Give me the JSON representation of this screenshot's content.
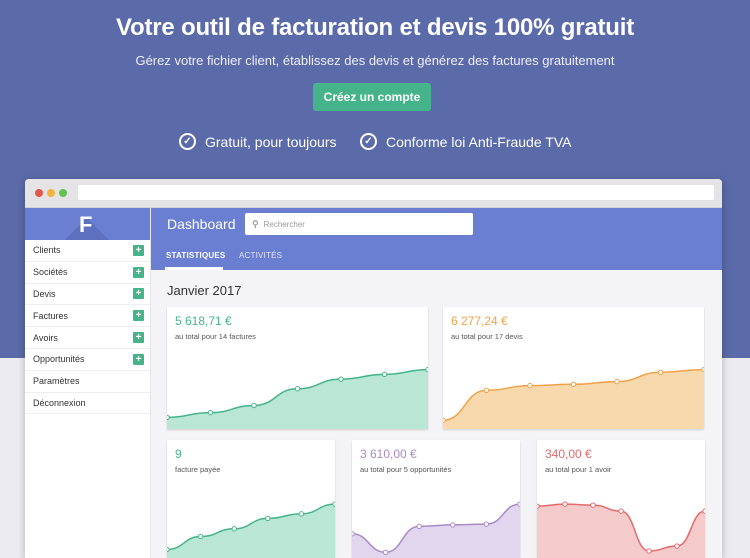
{
  "hero": {
    "headline": "Votre outil de facturation et devis 100% gratuit",
    "subline": "Gérez votre fichier client, établissez des devis et générez des factures gratuitement",
    "cta_label": "Créez un compte",
    "perks": [
      "Gratuit, pour toujours",
      "Conforme loi Anti-Fraude TVA"
    ]
  },
  "app": {
    "logo": "F",
    "title": "Dashboard",
    "search_placeholder": "Rechercher",
    "tabs": [
      "STATISTIQUES",
      "ACTIVITÉS"
    ],
    "month": "Janvier 2017",
    "sidebar": [
      {
        "label": "Clients",
        "add": true
      },
      {
        "label": "Sociétés",
        "add": true
      },
      {
        "label": "Devis",
        "add": true
      },
      {
        "label": "Factures",
        "add": true
      },
      {
        "label": "Avoirs",
        "add": true
      },
      {
        "label": "Opportunités",
        "add": true
      },
      {
        "label": "Paramètres",
        "add": false
      },
      {
        "label": "Déconnexion",
        "add": false
      }
    ],
    "cards": [
      {
        "amount": "5 618,71 €",
        "desc": "au total pour 14 factures",
        "color": "#45b48a",
        "fill": "#b9e6d5",
        "values": [
          2,
          3,
          4.5,
          8,
          10,
          11,
          12
        ]
      },
      {
        "amount": "6 277,24 €",
        "desc": "au total pour 17 devis",
        "color": "#f0a24a",
        "fill": "#f8d9ae",
        "values": [
          1,
          5.5,
          6.2,
          6.4,
          6.8,
          8.2,
          8.6
        ]
      },
      {
        "amount": "9",
        "desc": "facture payée",
        "color": "#45b48a",
        "fill": "#b9e6d5",
        "values": [
          1,
          3,
          4.2,
          5.8,
          6.5,
          8
        ]
      },
      {
        "amount": "3 610,00 €",
        "desc": "au total pour 5 opportunités",
        "color": "#a98ac9",
        "fill": "#e2d6ee",
        "values": [
          3,
          0.5,
          4,
          4.2,
          4.3,
          7
        ]
      },
      {
        "amount": "340,00 €",
        "desc": "au total pour 1 avoir",
        "color": "#e26a6a",
        "fill": "#f5caca",
        "values": [
          5,
          5.2,
          5.1,
          4.5,
          0.5,
          1,
          4.5
        ]
      }
    ]
  }
}
